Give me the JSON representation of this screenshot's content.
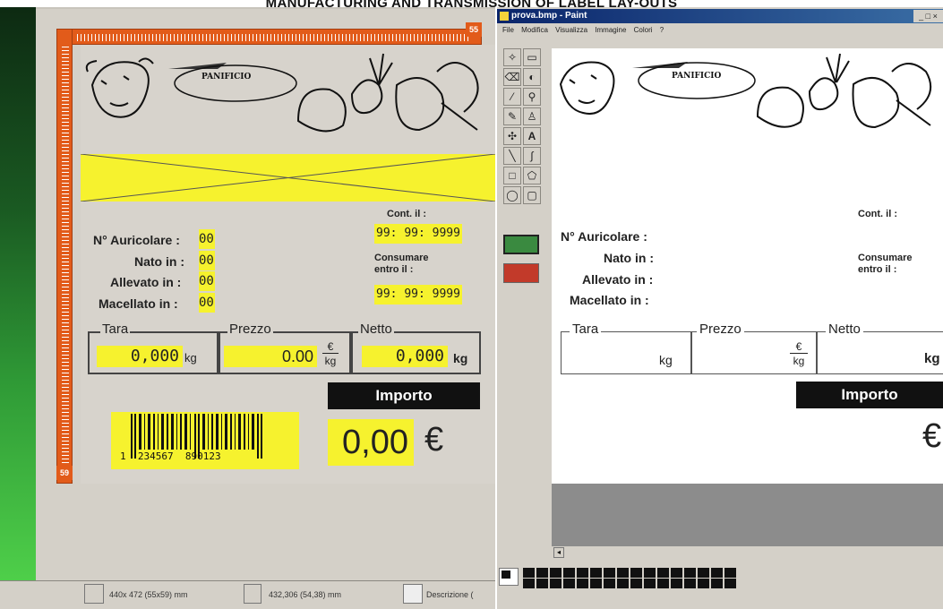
{
  "heading": "MANUFACTURING AND TRANSMISSION OF LABEL LAY-OUTS",
  "editor": {
    "ruler_top_tag": "55",
    "ruler_left_tag": "59",
    "logo_text": "PANIFICIO",
    "labels": {
      "auricolare": "N° Auricolare :",
      "nato": "Nato in :",
      "allevato": "Allevato in :",
      "macellato": "Macellato in :",
      "cont": "Cont. il :",
      "consumare": "Consumare entro il :"
    },
    "values": {
      "auricolare": "00",
      "nato": "00",
      "allevato": "00",
      "macellato": "00",
      "cont_date": "99: 99: 9999",
      "consumare_date": "99: 99: 9999"
    },
    "tara": {
      "legend": "Tara",
      "value": "0,000",
      "unit": "kg"
    },
    "prezzo": {
      "legend": "Prezzo",
      "value": "0.00",
      "unit_top": "€",
      "unit_bottom": "kg"
    },
    "netto": {
      "legend": "Netto",
      "value": "0,000",
      "unit": "kg"
    },
    "importo": {
      "label": "Importo",
      "value": "0,00",
      "currency": "€"
    },
    "barcode": {
      "digits": "1  234567  890123"
    }
  },
  "status_bar": {
    "size": "440x 472 (55x59) mm",
    "pos": "432,306 (54,38) mm",
    "desc": "Descrizione ("
  },
  "paint": {
    "title": "prova.bmp - Paint",
    "menu": [
      "File",
      "Modifica",
      "Visualizza",
      "Immagine",
      "Colori",
      "?"
    ],
    "logo_text": "PANIFICIO",
    "labels": {
      "auricolare": "N° Auricolare :",
      "nato": "Nato in :",
      "allevato": "Allevato in :",
      "macellato": "Macellato in :",
      "cont": "Cont. il :",
      "consumare": "Consumare entro il :"
    },
    "tara": {
      "legend": "Tara",
      "unit": "kg"
    },
    "prezzo": {
      "legend": "Prezzo",
      "unit_top": "€",
      "unit_bottom": "kg"
    },
    "netto": {
      "legend": "Netto",
      "unit": "kg"
    },
    "importo": {
      "label": "Importo",
      "currency": "€"
    },
    "window_buttons": "_ □ ×"
  },
  "colors": {
    "accent_orange": "#e25b1a",
    "label_yellow": "#f6f22e",
    "title_blue": "#0a246a"
  }
}
